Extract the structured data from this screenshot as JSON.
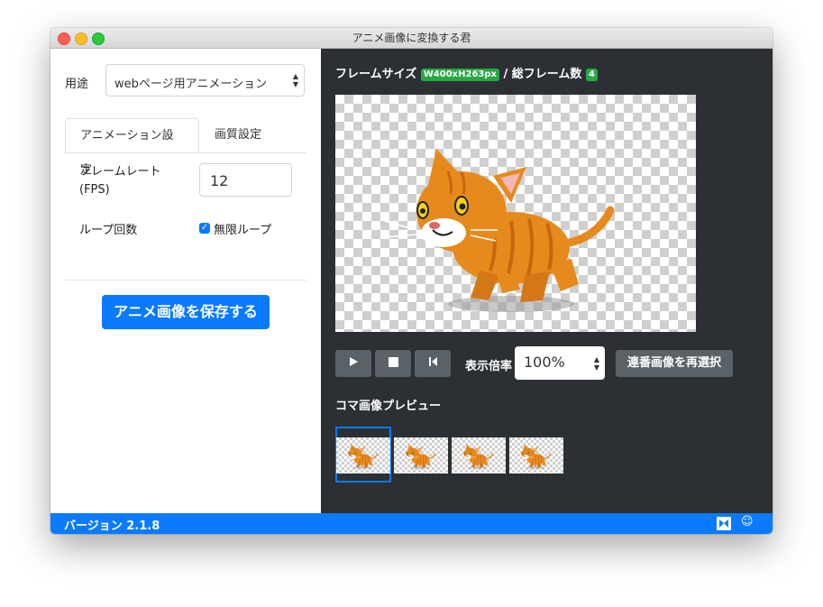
{
  "window": {
    "title": "アニメ画像に変換する君"
  },
  "sidebar": {
    "usage_label": "用途",
    "usage_value": "webページ用アニメーション",
    "tabs": [
      "アニメーション設定",
      "画質設定"
    ],
    "framerate_label_line1": "フレームレート",
    "framerate_label_line2": "(FPS)",
    "framerate_value": "12",
    "loop_label": "ループ回数",
    "infinite_loop_label": "無限ループ",
    "infinite_loop_checked": true,
    "save_button": "アニメ画像を保存する"
  },
  "main": {
    "frame_size_label": "フレームサイズ",
    "frame_size_badge": "W400xH263px",
    "separator": "/",
    "total_frames_label": "総フレーム数",
    "total_frames_badge": "4",
    "zoom_label": "表示倍率",
    "zoom_value": "100%",
    "reselect_button": "連番画像を再選択",
    "preview_title": "コマ画像プレビュー",
    "controls": [
      "play-icon",
      "stop-icon",
      "skip-back-icon"
    ]
  },
  "footer": {
    "version": "バージョン 2.1.8",
    "icons": [
      "window-icon",
      "smiley-icon"
    ]
  },
  "colors": {
    "accent": "#0a7aff",
    "badge": "#28a745",
    "panel": "#2c3034",
    "cat_orange": "#e68a1e"
  }
}
